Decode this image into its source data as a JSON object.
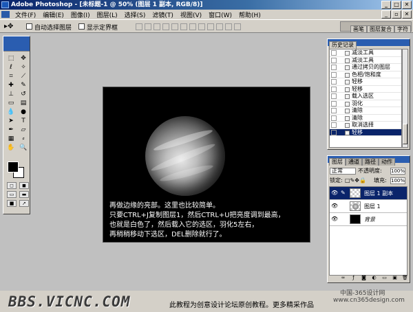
{
  "window": {
    "title": "Adobe Photoshop - [未标题-1 @ 50% (图层 1 副本, RGB/8)]"
  },
  "menubar": {
    "items": [
      "文件(F)",
      "编辑(E)",
      "图像(I)",
      "图层(L)",
      "选择(S)",
      "滤镜(T)",
      "视图(V)",
      "窗口(W)",
      "帮助(H)"
    ]
  },
  "options": {
    "tool_icon": "move-tool-icon",
    "auto_select_label": "自动选择图层",
    "show_bounds_label": "显示定界框",
    "auto_select_checked": false,
    "show_bounds_checked": false
  },
  "palette_well": {
    "tabs": [
      "画笔",
      "图层复合",
      "字符"
    ]
  },
  "canvas": {
    "caption": [
      "再做边缘的亮部。这里也比较简单。",
      "只要CTRL+J复制图层1，然后CTRL+U把亮度调到最高，",
      "也就是白色了，然后载入它的选区，羽化5左右，",
      "再稍稍移动下选区，DEL删除就行了。"
    ]
  },
  "history": {
    "tab": "历史记录",
    "items": [
      {
        "label": "减淡工具",
        "selected": false
      },
      {
        "label": "减淡工具",
        "selected": false
      },
      {
        "label": "通过拷贝的图层",
        "selected": false
      },
      {
        "label": "色相/饱和度",
        "selected": false
      },
      {
        "label": "轻移",
        "selected": false
      },
      {
        "label": "轻移",
        "selected": false
      },
      {
        "label": "载入选区",
        "selected": false
      },
      {
        "label": "羽化",
        "selected": false
      },
      {
        "label": "清除",
        "selected": false
      },
      {
        "label": "清除",
        "selected": false
      },
      {
        "label": "取消选择",
        "selected": false
      },
      {
        "label": "轻移",
        "selected": true
      }
    ]
  },
  "layers_panel": {
    "tabs": [
      "图层",
      "通道",
      "路径",
      "动作"
    ],
    "blend_mode": "正常",
    "opacity_label": "不透明度:",
    "opacity_value": "100%",
    "lock_label": "锁定:",
    "fill_label": "填充:",
    "fill_value": "100%",
    "layers": [
      {
        "name": "图层 1 副本",
        "selected": true,
        "visible": true
      },
      {
        "name": "图层 1",
        "selected": false,
        "visible": true
      },
      {
        "name": "背景",
        "selected": false,
        "visible": true
      }
    ]
  },
  "footer": {
    "logo": "BBS.VICNC.COM",
    "text": "此教程为创意设计论坛原创教程。更多精采作品",
    "watermark_line1": "中国-365设计网",
    "watermark_line2": "www.cn365design.com"
  },
  "colors": {
    "title_bar": "#0a246a",
    "ui_gray": "#d4d0c8",
    "workspace": "#c0c0c0",
    "selection": "#0a246a"
  }
}
